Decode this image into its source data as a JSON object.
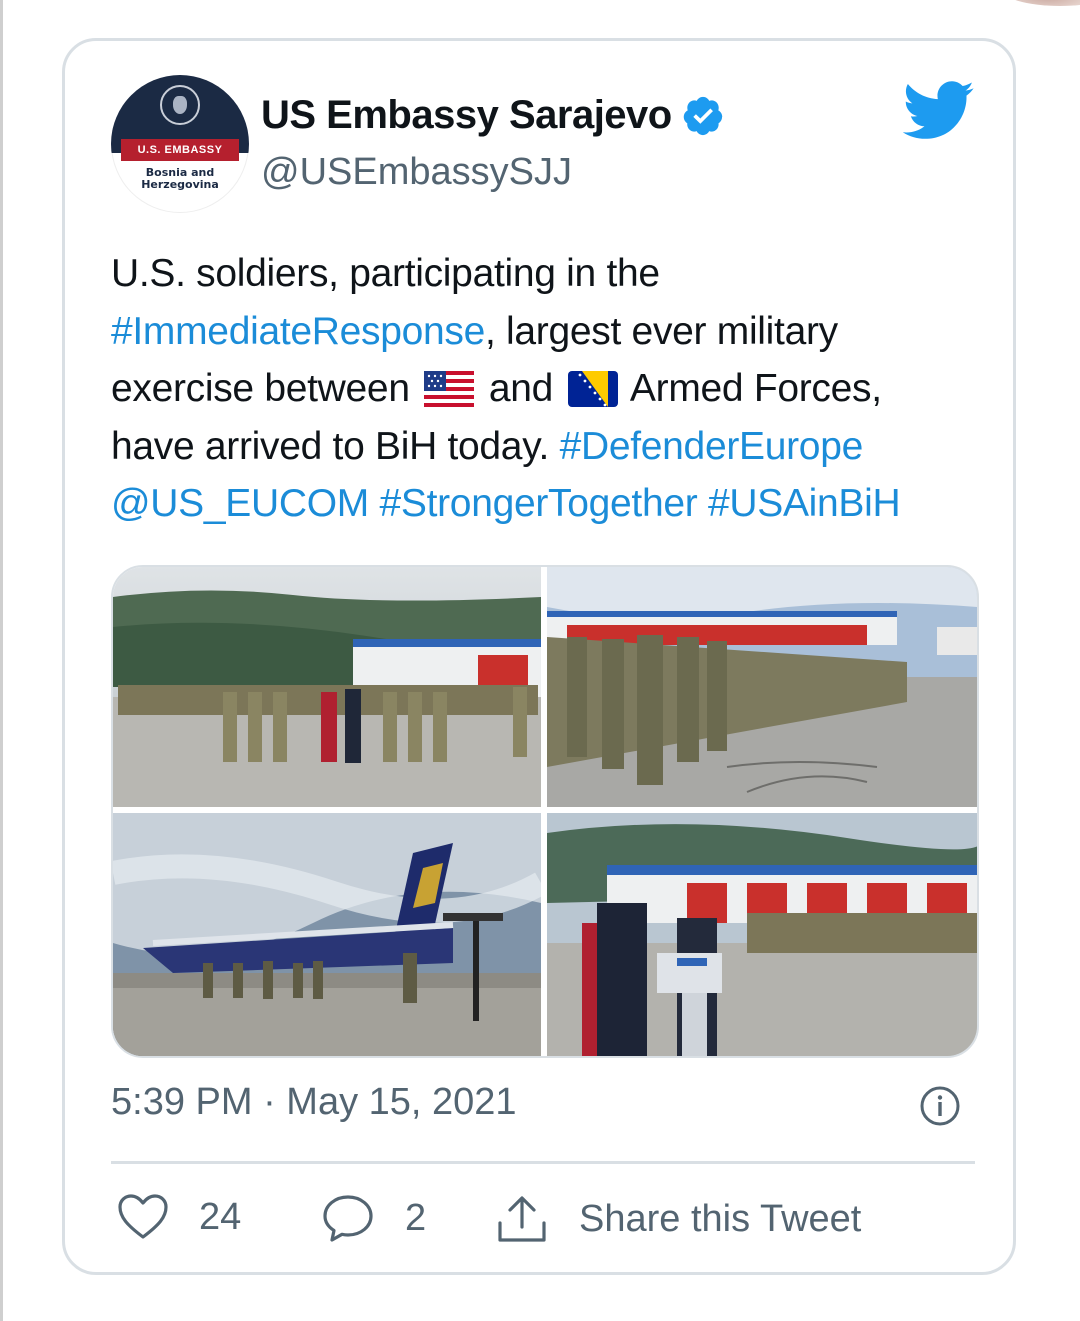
{
  "tweet": {
    "author": {
      "name": "US Embassy Sarajevo",
      "handle": "@USEmbassySJJ",
      "verified": true,
      "avatar": {
        "band_text": "U.S. EMBASSY",
        "location_line1": "Bosnia and",
        "location_line2": "Herzegovina"
      }
    },
    "text": {
      "l1": "U.S. soldiers, participating in the",
      "tag_immediate": "#ImmediateResponse",
      "l2_rest": ", largest ever military",
      "l3_a": "exercise between",
      "l3_b": "and",
      "l3_c": "Armed Forces,",
      "l4_a": "have arrived to BiH today.",
      "tag_defender": "#DefenderEurope",
      "mention_eucom": "@US_EUCOM",
      "tag_stronger": "#StrongerTogether",
      "tag_usainbih": "#USAinBiH",
      "flag_1": "us-flag-emoji",
      "flag_2": "bosnia-flag-emoji"
    },
    "media_photos": [
      "troops-formation-hangar-photo",
      "soldiers-saluting-row-photo",
      "cargo-plane-troops-photo",
      "press-podium-speech-photo"
    ],
    "timestamp": "5:39 PM · May 15, 2021",
    "actions": {
      "likes": "24",
      "replies": "2",
      "share_label": "Share this Tweet"
    }
  },
  "colors": {
    "link": "#1b8cd8",
    "twitter_blue": "#1d9bf0",
    "muted": "#536471",
    "border": "#d9dfe4"
  }
}
